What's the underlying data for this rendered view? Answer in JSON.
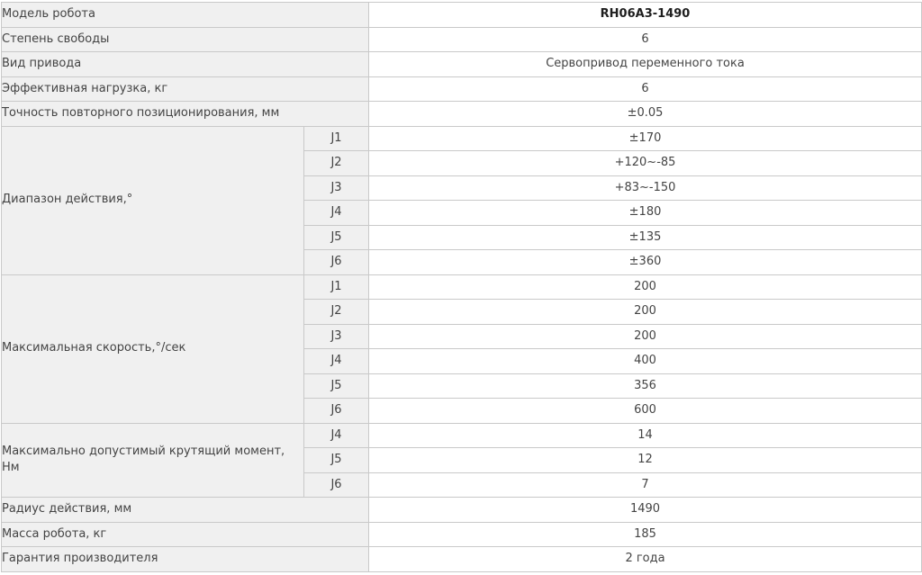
{
  "model": {
    "label": "Модель робота",
    "value": "RH06A3-1490"
  },
  "dof": {
    "label": "Степень свободы",
    "value": "6"
  },
  "drive": {
    "label": "Вид привода",
    "value": "Сервопривод переменного тока"
  },
  "payload": {
    "label": "Эффективная нагрузка, кг",
    "value": "6"
  },
  "repeatability": {
    "label": "Точность повторного позиционирования, мм",
    "value": "±0.05"
  },
  "range": {
    "label": "Диапазон действия,°",
    "rows": [
      {
        "axis": "J1",
        "value": "±170"
      },
      {
        "axis": "J2",
        "value": "+120~-85"
      },
      {
        "axis": "J3",
        "value": "+83~-150"
      },
      {
        "axis": "J4",
        "value": "±180"
      },
      {
        "axis": "J5",
        "value": "±135"
      },
      {
        "axis": "J6",
        "value": "±360"
      }
    ]
  },
  "speed": {
    "label": "Максимальная скорость,°/сек",
    "rows": [
      {
        "axis": "J1",
        "value": "200"
      },
      {
        "axis": "J2",
        "value": "200"
      },
      {
        "axis": "J3",
        "value": "200"
      },
      {
        "axis": "J4",
        "value": "400"
      },
      {
        "axis": "J5",
        "value": "356"
      },
      {
        "axis": "J6",
        "value": "600"
      }
    ]
  },
  "torque": {
    "label": "Максимально допустимый крутящий момент, Нм",
    "rows": [
      {
        "axis": "J4",
        "value": "14"
      },
      {
        "axis": "J5",
        "value": "12"
      },
      {
        "axis": "J6",
        "value": "7"
      }
    ]
  },
  "reach": {
    "label": "Радиус действия, мм",
    "value": "1490"
  },
  "mass": {
    "label": "Масса робота, кг",
    "value": "185"
  },
  "warranty": {
    "label": "Гарантия производителя",
    "value": "2 года"
  }
}
